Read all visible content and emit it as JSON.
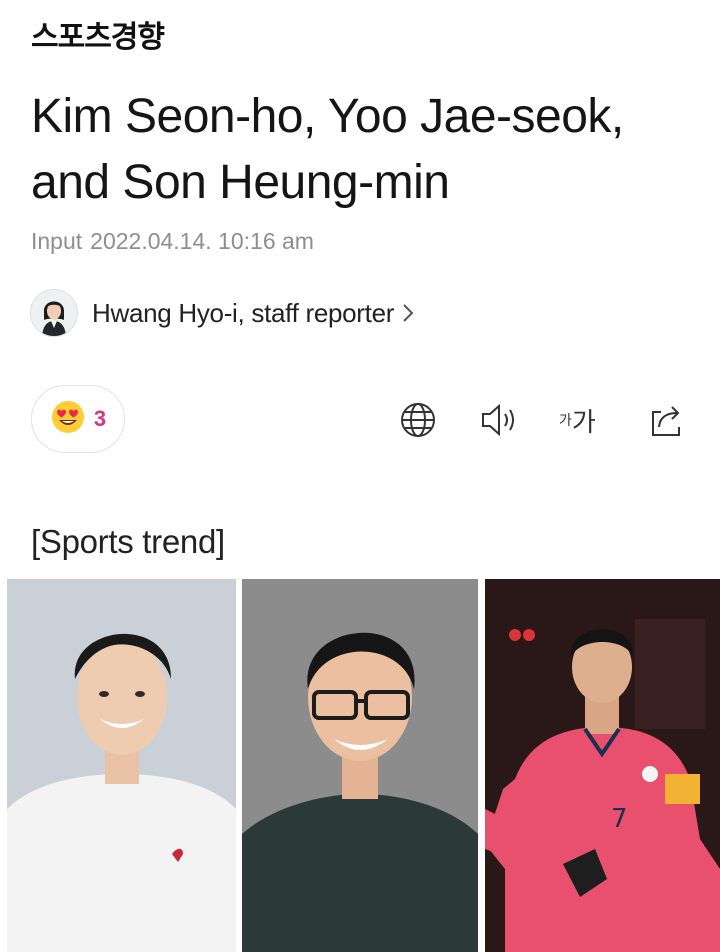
{
  "brand": {
    "logo_text": "스포츠경향"
  },
  "article": {
    "headline": "Kim Seon-ho, Yoo Jae-seok, and Son Heung-min",
    "input_label": "Input",
    "input_time": "2022.04.14. 10:16 am",
    "reporter": "Hwang Hyo-i, staff reporter",
    "section_tag": "[Sports trend]"
  },
  "reaction": {
    "emoji": "heart-eyes-emoji",
    "count": "3"
  },
  "toolbar": {
    "icons": [
      "globe-icon",
      "speaker-icon",
      "font-size-icon",
      "share-icon"
    ],
    "font_small": "가",
    "font_large": "가"
  },
  "photos": [
    {
      "name": "kim-seon-ho-photo",
      "bg": "#c9cfd6",
      "shirt": "#f4f4f4"
    },
    {
      "name": "yoo-jae-seok-photo",
      "bg": "#8f8f8f",
      "shirt": "#2e3b38"
    },
    {
      "name": "son-heung-min-photo",
      "bg": "#2a1818",
      "shirt": "#e8506e",
      "jersey_number": "7"
    }
  ],
  "colors": {
    "reaction_count": "#d6357f",
    "meta_gray": "#8e8e8e"
  }
}
